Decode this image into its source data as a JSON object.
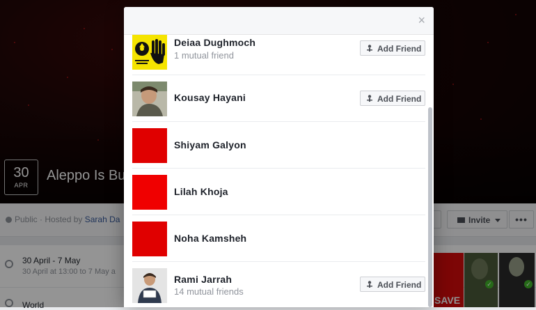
{
  "event": {
    "date_day": "30",
    "date_month": "APR",
    "title": "Aleppo Is Bu",
    "hosted_prefix": "Public · Hosted by ",
    "hosted_name": "Sarah Da",
    "invite_label": "Invite",
    "more_label": "•••",
    "date_line": "30 April - 7 May",
    "date_sub": "30 April at 13:00 to 7 May a",
    "location_line": "World"
  },
  "modal": {
    "close_label": "×",
    "add_friend_label": "Add Friend",
    "people": [
      {
        "name": "Deiaa Dughmoch",
        "mutual": "1 mutual friend",
        "has_button": true
      },
      {
        "name": "Kousay Hayani",
        "mutual": "",
        "has_button": true
      },
      {
        "name": "Shiyam Galyon",
        "mutual": "",
        "has_button": false
      },
      {
        "name": "Lilah Khoja",
        "mutual": "",
        "has_button": false
      },
      {
        "name": "Noha Kamsheh",
        "mutual": "",
        "has_button": false
      },
      {
        "name": "Rami Jarrah",
        "mutual": "14 mutual friends",
        "has_button": true
      }
    ]
  },
  "thumbnails": {
    "save_text": "SAVE",
    "check": "✓"
  },
  "colors": {
    "accent_link": "#365899",
    "red_avatar": "#e00000",
    "yellow_logo": "#f5e400",
    "check_green": "#42b72a"
  }
}
